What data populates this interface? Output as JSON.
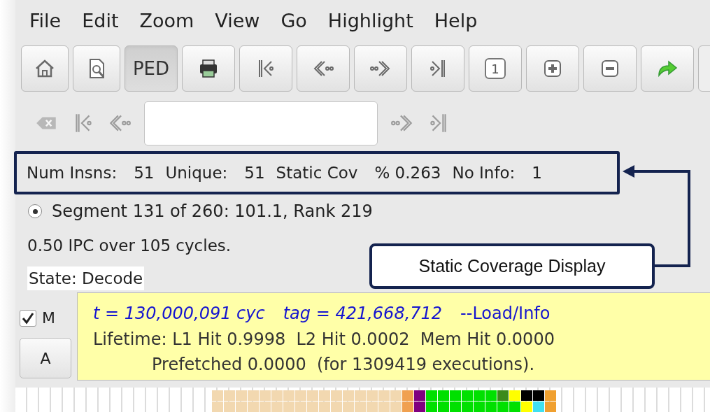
{
  "menu": [
    "File",
    "Edit",
    "Zoom",
    "View",
    "Go",
    "Highlight",
    "Help"
  ],
  "toolbar": [
    {
      "kind": "icon",
      "selected": false
    },
    {
      "kind": "icon",
      "selected": false
    },
    {
      "kind": "text",
      "label": "PED",
      "selected": true
    },
    {
      "kind": "icon",
      "selected": false
    },
    {
      "kind": "icon",
      "selected": false
    },
    {
      "kind": "icon",
      "selected": false
    },
    {
      "kind": "icon",
      "selected": false
    },
    {
      "kind": "icon",
      "selected": false
    },
    {
      "kind": "text",
      "label": "1",
      "selected": false
    },
    {
      "kind": "icon",
      "selected": false
    },
    {
      "kind": "icon",
      "selected": false
    },
    {
      "kind": "icon",
      "selected": false
    }
  ],
  "stats": [
    {
      "label": "Num Insns:",
      "value": "51"
    },
    {
      "label": "Unique:",
      "value": "51"
    },
    {
      "label": "Static Cov",
      "value": "% 0.263"
    },
    {
      "label": "No Info:",
      "value": "1"
    }
  ],
  "segment": {
    "label": "Segment 131 of 260: 101.1, Rank 219",
    "selected": true
  },
  "ipc": "0.50 IPC over 105 cycles.",
  "state": "State: Decode",
  "callout": "Static Coverage Display",
  "checkbox": {
    "label": "M",
    "checked": true
  },
  "button": "A",
  "tooltip": {
    "time": "t = 130,000,091 cyc",
    "tag": "tag = 421,668,712",
    "link": "--Load/Info",
    "lines": [
      "Lifetime: L1 Hit 0.9998  L2 Hit 0.0002  Mem Hit 0.0000",
      "Prefetched 0.0000  (for 1309419 executions)."
    ]
  },
  "strip": [
    {
      "cells": [
        {
          "color": "#f2d8b0"
        },
        {
          "color": "#f2d8b0"
        },
        {
          "color": "#f2d8b0"
        },
        {
          "color": "#f2d8b0"
        },
        {
          "color": "#f2d8b0"
        },
        {
          "color": "#f2d8b0"
        },
        {
          "color": "#f2d8b0"
        },
        {
          "color": "#f2d8b0"
        },
        {
          "color": "#f2d8b0"
        },
        {
          "color": "#f2d8b0"
        },
        {
          "color": "#f2d8b0"
        },
        {
          "color": "#f2d8b0"
        },
        {
          "color": "#f2d8b0"
        },
        {
          "color": "#f2d8b0"
        },
        {
          "color": "#f2d8b0"
        },
        {
          "color": "#f2d8b0"
        },
        {
          "color": "#f0a050"
        },
        {
          "color": "#800080"
        },
        {
          "color": "#00e000"
        },
        {
          "color": "#00e000"
        },
        {
          "color": "#00e000"
        },
        {
          "color": "#00e000"
        },
        {
          "color": "#00e000"
        },
        {
          "color": "#00e000"
        },
        {
          "color": "#3a8a1a"
        },
        {
          "color": "#ffff00"
        },
        {
          "color": "#000000"
        },
        {
          "color": "#000000"
        },
        {
          "color": "#f0a030"
        }
      ]
    },
    {
      "cells": [
        {
          "color": "#f2d8b0"
        },
        {
          "color": "#f2d8b0"
        },
        {
          "color": "#f2d8b0"
        },
        {
          "color": "#f2d8b0"
        },
        {
          "color": "#f2d8b0"
        },
        {
          "color": "#f2d8b0"
        },
        {
          "color": "#f2d8b0"
        },
        {
          "color": "#f2d8b0"
        },
        {
          "color": "#f2d8b0"
        },
        {
          "color": "#f2d8b0"
        },
        {
          "color": "#f2d8b0"
        },
        {
          "color": "#f2d8b0"
        },
        {
          "color": "#f2d8b0"
        },
        {
          "color": "#f2d8b0"
        },
        {
          "color": "#f2d8b0"
        },
        {
          "color": "#f2d8b0"
        },
        {
          "color": "#f0a050"
        },
        {
          "color": "#800080"
        },
        {
          "color": "#00e000"
        },
        {
          "color": "#00e000"
        },
        {
          "color": "#00e000"
        },
        {
          "color": "#00e000"
        },
        {
          "color": "#00e000"
        },
        {
          "color": "#00e000"
        },
        {
          "color": "#00e000"
        },
        {
          "color": "#00e000"
        },
        {
          "color": "#ffff00"
        },
        {
          "color": "#40e0f0"
        },
        {
          "color": "#f0a030"
        }
      ]
    }
  ]
}
